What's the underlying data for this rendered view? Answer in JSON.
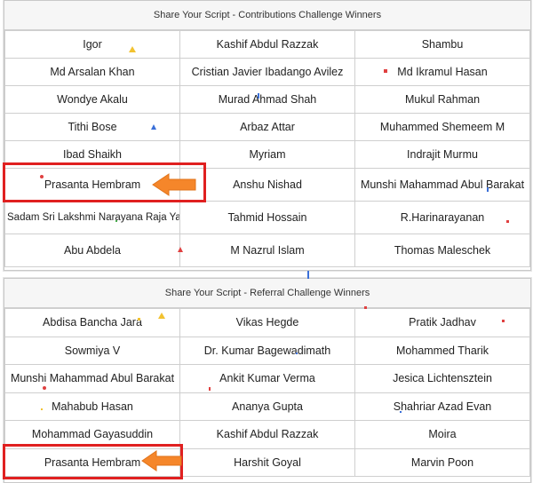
{
  "contributions": {
    "title": "Share Your Script - Contributions Challenge Winners",
    "rows": [
      [
        "Igor",
        "Kashif Abdul Razzak",
        "Shambu"
      ],
      [
        "Md Arsalan Khan",
        "Cristian Javier Ibadango Avilez",
        "Md Ikramul Hasan"
      ],
      [
        "Wondye Akalu",
        "Murad Ahmad Shah",
        "Mukul Rahman"
      ],
      [
        "Tithi Bose",
        "Arbaz Attar",
        "Muhammed Shemeem M"
      ],
      [
        "Ibad Shaikh",
        "Myriam",
        "Indrajit Murmu"
      ],
      [
        "Prasanta Hembram",
        "Anshu Nishad",
        "Munshi Mahammad Abul Barakat"
      ],
      [
        "Sadam Sri Lakshmi Narayana Raja Yadav",
        "Tahmid Hossain",
        "R.Harinarayanan"
      ],
      [
        "Abu Abdela",
        "M Nazrul Islam",
        "Thomas Maleschek"
      ]
    ]
  },
  "referral": {
    "title": "Share Your Script - Referral Challenge Winners",
    "rows": [
      [
        "Abdisa Bancha Jara",
        "Vikas Hegde",
        "Pratik Jadhav"
      ],
      [
        "Sowmiya V",
        "Dr. Kumar Bagewadimath",
        "Mohammed Tharik"
      ],
      [
        "Munshi Mahammad Abul Barakat",
        "Ankit Kumar Verma",
        "Jesica Lichtensztein"
      ],
      [
        "Mahabub Hasan",
        "Ananya Gupta",
        "Shahriar Azad Evan"
      ],
      [
        "Mohammad Gayasuddin",
        "Kashif Abdul Razzak",
        "Moira"
      ],
      [
        "Prasanta Hembram",
        "Harshit Goyal",
        "Marvin Poon"
      ]
    ]
  },
  "colors": {
    "highlight": "#e02020",
    "arrow": "#f5862a"
  }
}
